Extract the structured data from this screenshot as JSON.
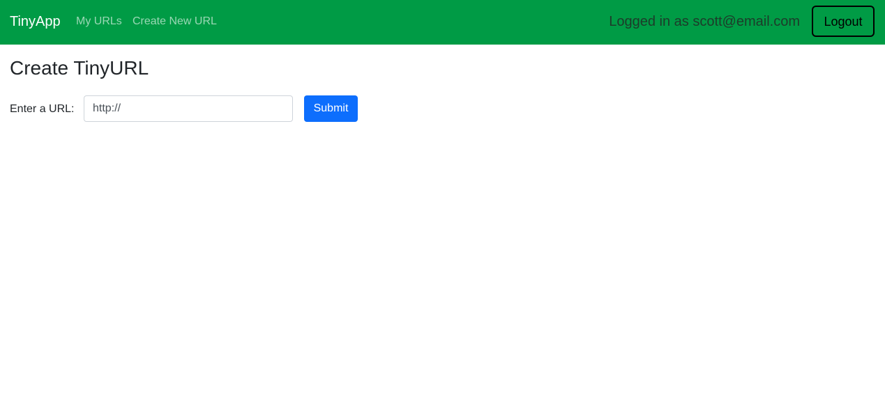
{
  "navbar": {
    "brand": "TinyApp",
    "links": [
      {
        "label": "My URLs"
      },
      {
        "label": "Create New URL"
      }
    ],
    "logged_in_text": "Logged in as scott@email.com",
    "logout_label": "Logout",
    "background_color": "#009b45"
  },
  "main": {
    "title": "Create TinyURL",
    "form": {
      "url_label": "Enter a URL:",
      "url_placeholder": "http://",
      "url_value": "",
      "submit_label": "Submit"
    }
  },
  "colors": {
    "primary": "#0d6efd",
    "navbar": "#009b45"
  }
}
